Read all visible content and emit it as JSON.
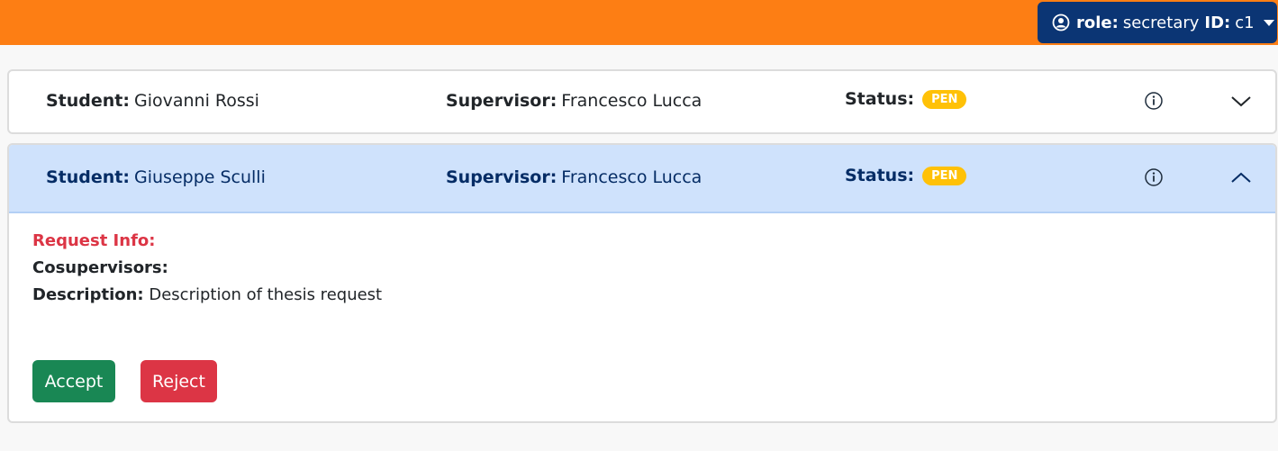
{
  "navbar": {
    "role_label": "role:",
    "role_value": "secretary",
    "id_label": "ID:",
    "id_value": "c1"
  },
  "colors": {
    "navbar_bg": "#fd7e14",
    "role_button_bg": "#0b3574",
    "expanded_header_bg": "#cfe2fc",
    "badge_bg": "#ffc107",
    "accept_bg": "#198754",
    "reject_bg": "#dc3545"
  },
  "requests": [
    {
      "student_label": "Student:",
      "student": "Giovanni Rossi",
      "supervisor_label": "Supervisor:",
      "supervisor": "Francesco Lucca",
      "status_label": "Status:",
      "status": "PEN",
      "expanded": false
    },
    {
      "student_label": "Student:",
      "student": "Giuseppe Sculli",
      "supervisor_label": "Supervisor:",
      "supervisor": "Francesco Lucca",
      "status_label": "Status:",
      "status": "PEN",
      "expanded": true,
      "details": {
        "title": "Request Info:",
        "cosupervisors_label": "Cosupervisors:",
        "cosupervisors": "",
        "description_label": "Description:",
        "description": "Description of thesis request"
      },
      "actions": {
        "accept": "Accept",
        "reject": "Reject"
      }
    }
  ],
  "icons": {
    "user": "user-circle-icon",
    "info": "info-circle-icon",
    "chevron_down": "chevron-down-icon",
    "chevron_up": "chevron-up-icon",
    "caret": "caret-down-icon"
  }
}
